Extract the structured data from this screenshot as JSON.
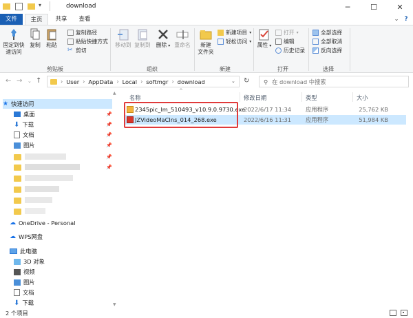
{
  "window": {
    "title": "download"
  },
  "ribbon_tabs": {
    "file": "文件",
    "home": "主页",
    "share": "共享",
    "view": "查看"
  },
  "ribbon": {
    "clipboard": {
      "pin": "固定到快\n速访问",
      "copy": "复制",
      "paste": "粘贴",
      "copy_path": "复制路径",
      "paste_shortcut": "粘贴快捷方式",
      "cut": "剪切",
      "label": "剪贴板"
    },
    "organize": {
      "move_to": "移动到",
      "copy_to": "复制到",
      "delete": "删除",
      "rename": "重命名",
      "label": "组织"
    },
    "new": {
      "new_folder": "新建\n文件夹",
      "new_item": "新建项目",
      "easy_access": "轻松访问",
      "label": "新建"
    },
    "open": {
      "properties": "属性",
      "open": "打开",
      "edit": "编辑",
      "history": "历史记录",
      "label": "打开"
    },
    "select": {
      "select_all": "全部选择",
      "select_none": "全部取消",
      "invert": "反向选择",
      "label": "选择"
    }
  },
  "address": {
    "crumbs": [
      "User",
      "AppData",
      "Local",
      "softmgr",
      "download"
    ]
  },
  "search": {
    "placeholder": "在 download 中搜索"
  },
  "sidebar": {
    "quick_access": "快速访问",
    "items": [
      {
        "label": "桌面"
      },
      {
        "label": "下载"
      },
      {
        "label": "文档"
      },
      {
        "label": "图片"
      }
    ],
    "onedrive": "OneDrive - Personal",
    "wps": "WPS网盘",
    "this_pc": "此电脑",
    "pc_items": [
      {
        "label": "3D 对象"
      },
      {
        "label": "视频"
      },
      {
        "label": "图片"
      },
      {
        "label": "文档"
      },
      {
        "label": "下载"
      }
    ]
  },
  "columns": {
    "name": "名称",
    "date": "修改日期",
    "type": "类型",
    "size": "大小"
  },
  "files": [
    {
      "name": "2345pic_lm_510493_v10.9.0.9730.exe",
      "date": "2022/6/17 11:34",
      "type": "应用程序",
      "size": "25,762 KB"
    },
    {
      "name": "JZVideoMaCIns_014_268.exe",
      "date": "2022/6/16 11:31",
      "type": "应用程序",
      "size": "51,984 KB"
    }
  ],
  "status": {
    "count": "2 个项目"
  },
  "colors": {
    "accent": "#1a5fb4",
    "selection": "#cce8ff",
    "highlight_border": "#e03a3a"
  }
}
